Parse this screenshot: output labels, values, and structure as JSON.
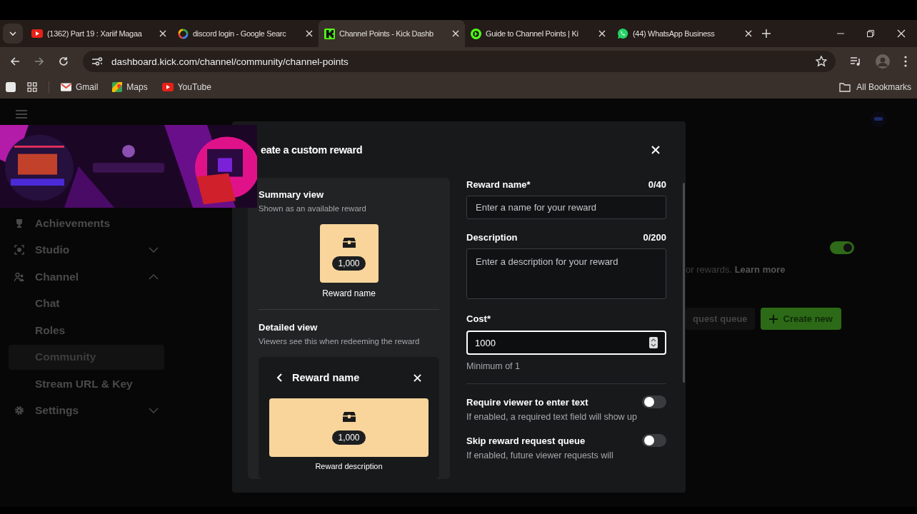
{
  "browser": {
    "tabs": [
      {
        "title": "(1362) Part 19 : Xariif Magaa",
        "kind": "video",
        "selected": false
      },
      {
        "title": "discord login - Google Searc",
        "kind": "search",
        "selected": false
      },
      {
        "title": "Channel Points - Kick Dashb",
        "kind": "dashboard",
        "selected": true
      },
      {
        "title": "Guide to Channel Points | Ki",
        "kind": "guide",
        "selected": false
      },
      {
        "title": "(44) WhatsApp Business",
        "kind": "messenger",
        "selected": false
      }
    ],
    "url": "dashboard.kick.com/channel/community/channel-points",
    "bookmarks": [
      {
        "label": "Gmail",
        "kind": "mail"
      },
      {
        "label": "Maps",
        "kind": "map"
      },
      {
        "label": "YouTube",
        "kind": "video"
      }
    ],
    "all_bookmarks": "All Bookmarks"
  },
  "sidebar": {
    "items": [
      {
        "label": "Achievements",
        "kind": "link",
        "selected": false
      },
      {
        "label": "Studio",
        "kind": "group",
        "expanded": false,
        "selected": false
      },
      {
        "label": "Channel",
        "kind": "group",
        "expanded": true,
        "selected": false,
        "children": [
          {
            "label": "Chat",
            "selected": false
          },
          {
            "label": "Roles",
            "selected": false
          },
          {
            "label": "Community",
            "selected": true
          },
          {
            "label": "Stream URL & Key",
            "selected": false
          }
        ]
      },
      {
        "label": "Settings",
        "kind": "group",
        "expanded": false,
        "selected": false
      }
    ]
  },
  "background": {
    "enabled": {
      "on": true
    },
    "note": "or rewards.",
    "link": "Learn more",
    "queue_button": "quest queue",
    "create_button": "Create new"
  },
  "modal": {
    "title": "eate a custom reward",
    "summary": {
      "heading": "Summary view",
      "subheading": "Shown as an available reward",
      "cost": "1,000",
      "name": "Reward name"
    },
    "detailed": {
      "heading": "Detailed view",
      "subheading": "Viewers see this when redeeming the reward",
      "title": "Reward name",
      "cost": "1,000",
      "description": "Reward description"
    },
    "name_field": {
      "label": "Reward name*",
      "counter": "0/40",
      "placeholder": "Enter a name for your reward"
    },
    "description_field": {
      "label": "Description",
      "counter": "0/200",
      "placeholder": "Enter a description for your reward"
    },
    "cost_field": {
      "label": "Cost*",
      "value": "1000",
      "hint": "Minimum of 1"
    },
    "toggles": [
      {
        "label": "Require viewer to enter text",
        "hint": "If enabled, a required text field will show up",
        "on": false
      },
      {
        "label": "Skip reward request queue",
        "hint": "If enabled, future viewer requests will",
        "on": false
      }
    ]
  }
}
